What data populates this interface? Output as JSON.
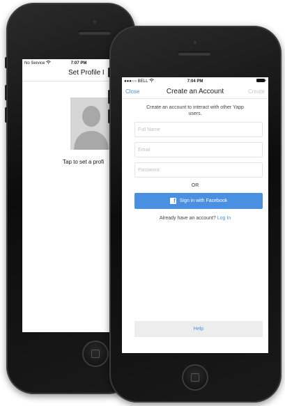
{
  "back_phone": {
    "status": {
      "left": "No Service",
      "time": "7:07 PM"
    },
    "nav_title": "Set Profile I",
    "caption": "Tap to set a profi"
  },
  "front_phone": {
    "status": {
      "left": "●●●○○ BELL",
      "time": "7:04 PM"
    },
    "nav": {
      "close": "Close",
      "title": "Create an Account",
      "create": "Create"
    },
    "intro": "Create an account to interact with other Yapp users.",
    "fields": {
      "full_name_placeholder": "Full Name",
      "email_placeholder": "Email",
      "password_placeholder": "Password"
    },
    "or": "OR",
    "facebook_button": "Sign in with Facebook",
    "account_prompt": "Already have an account?",
    "login_link": "Log In",
    "help": "Help"
  },
  "colors": {
    "accent": "#4a90e2",
    "disabled": "#c8c8c8",
    "help_bg": "#ededed"
  },
  "icons": [
    "wifi-icon",
    "facebook-icon",
    "battery-icon",
    "person-silhouette-icon"
  ]
}
